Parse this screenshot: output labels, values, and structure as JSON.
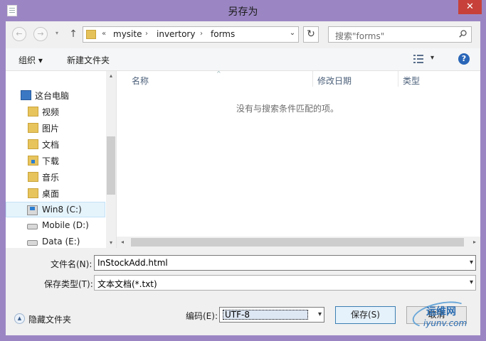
{
  "window": {
    "title": "另存为",
    "close_glyph": "✕"
  },
  "nav": {
    "back_glyph": "←",
    "forward_glyph": "→",
    "dropdown_glyph": "▾",
    "up_glyph": "↑"
  },
  "address": {
    "overflow": "«",
    "segments": [
      "mysite",
      "invertory",
      "forms"
    ],
    "separator": "›",
    "dropdown_glyph": "⌄",
    "refresh_glyph": "↻"
  },
  "search": {
    "placeholder": "搜索\"forms\""
  },
  "toolbar": {
    "organize": "组织 ▾",
    "new_folder": "新建文件夹",
    "view_dd": "▾",
    "help": "?"
  },
  "sidebar": {
    "items": [
      {
        "label": "这台电脑",
        "icon": "computer-icon"
      },
      {
        "label": "视频",
        "icon": "folder-icon"
      },
      {
        "label": "图片",
        "icon": "folder-icon"
      },
      {
        "label": "文档",
        "icon": "folder-icon"
      },
      {
        "label": "下载",
        "icon": "download-folder-icon"
      },
      {
        "label": "音乐",
        "icon": "folder-icon"
      },
      {
        "label": "桌面",
        "icon": "folder-icon"
      },
      {
        "label": "Win8 (C:)",
        "icon": "windows-drive-icon",
        "selected": true
      },
      {
        "label": "Mobile (D:)",
        "icon": "drive-icon"
      },
      {
        "label": "Data (E:)",
        "icon": "drive-icon"
      }
    ],
    "scroll_up": "▴",
    "scroll_down": "▾"
  },
  "filelist": {
    "columns": [
      "名称",
      "修改日期",
      "类型"
    ],
    "sort_glyph": "^",
    "empty_message": "没有与搜索条件匹配的项。",
    "scroll_left": "◂",
    "scroll_right": "▸"
  },
  "form": {
    "filename_label": "文件名(N):",
    "filename_value": "InStockAdd.html",
    "type_label": "保存类型(T):",
    "type_value": "文本文档(*.txt)",
    "encoding_label": "编码(E):",
    "encoding_value": "UTF-8",
    "dd_glyph": "▾"
  },
  "footer": {
    "hide_folders": "隐藏文件夹",
    "hide_glyph": "▲",
    "save": "保存(S)",
    "cancel": "取消"
  },
  "watermark": {
    "top": "运维网",
    "bottom": "iyunv.com"
  }
}
